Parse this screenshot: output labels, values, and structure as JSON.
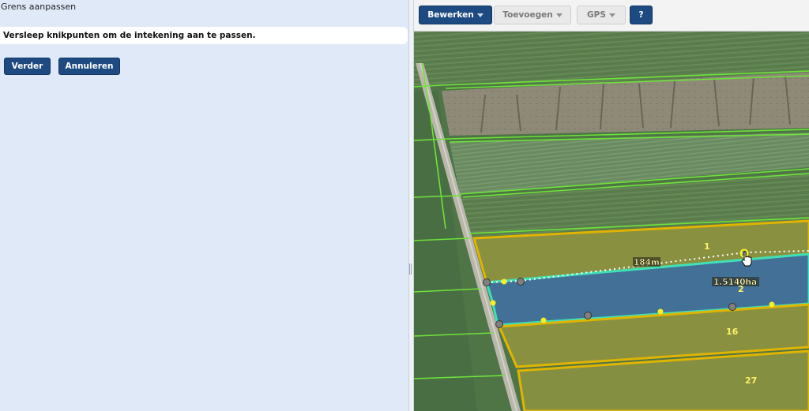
{
  "left_panel": {
    "title": "Grens aanpassen",
    "instruction": "Versleep knikpunten om de intekening aan te passen.",
    "buttons": {
      "continue": "Verder",
      "cancel": "Annuleren"
    }
  },
  "toolbar": {
    "edit": "Bewerken",
    "add": "Toevoegen",
    "gps": "GPS",
    "help": "?"
  },
  "map": {
    "measure_length": "184m",
    "measure_area": "1.5140ha",
    "parcel_labels": [
      "1",
      "2",
      "16",
      "27"
    ],
    "colors": {
      "parcel_border": "#e0b400",
      "selected_fill": "#3f6fb8",
      "selected_border": "#3ee0b8",
      "vertex": "#f5ef25",
      "handle": "#808080",
      "field_lines": "#6ee23a"
    }
  }
}
